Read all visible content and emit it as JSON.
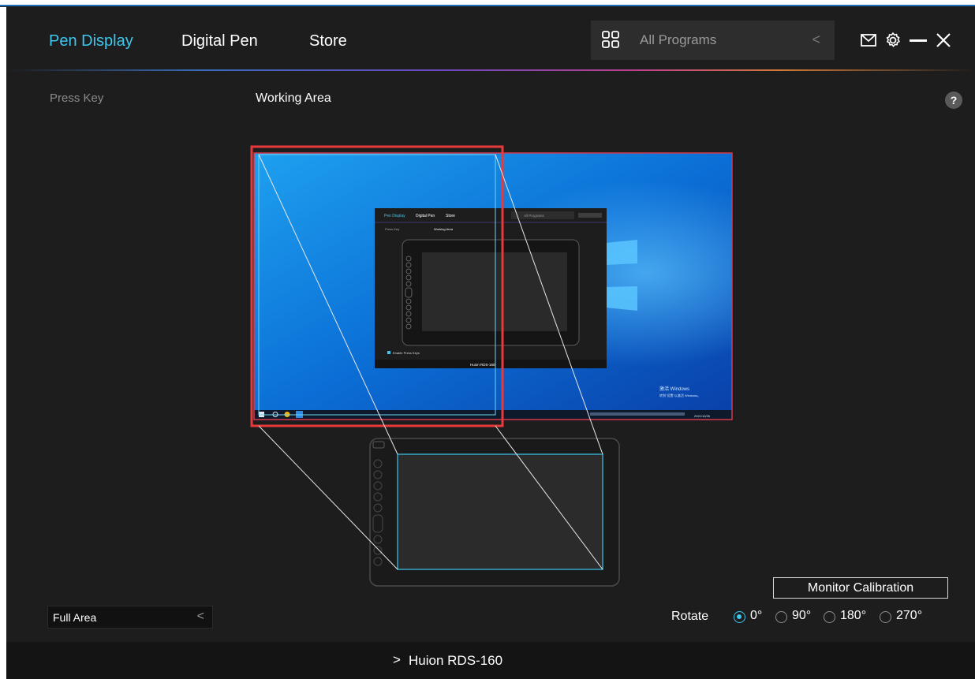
{
  "header": {
    "tabs": [
      {
        "label": "Pen Display",
        "active": true
      },
      {
        "label": "Digital Pen",
        "active": false
      },
      {
        "label": "Store",
        "active": false
      }
    ],
    "programs": {
      "label": "All Programs"
    },
    "icons": [
      "grid-icon",
      "mail-icon",
      "gear-icon",
      "minimize-icon",
      "close-icon"
    ]
  },
  "subheader": {
    "left": "Press Key",
    "center": "Working Area",
    "help": "?"
  },
  "preview": {
    "mini_tabs": [
      "Pen Display",
      "Digital Pen",
      "Store"
    ],
    "mini_programs": "All Programs",
    "mini_sub_left": "Press Key",
    "mini_sub_center": "Working Area",
    "mini_checkbox": "Enable Press Keys",
    "mini_device": "Huion RDS-160",
    "watermark_1": "激活 Windows",
    "watermark_2": "转到\"设置\"以激活 Windows。",
    "taskbar_date": "2021/10/26"
  },
  "controls": {
    "monitor_calibration": "Monitor Calibration",
    "area": "Full Area",
    "rotate_label": "Rotate",
    "rotate_options": [
      "0°",
      "90°",
      "180°",
      "270°"
    ],
    "rotate_selected": "0°"
  },
  "footer": {
    "device": "Huion RDS-160"
  },
  "colors": {
    "accent": "#3ec7ef",
    "selection": "#e8393b",
    "screen_border": "#d63a4e",
    "background": "#1d1d1d",
    "footer": "#141414"
  }
}
